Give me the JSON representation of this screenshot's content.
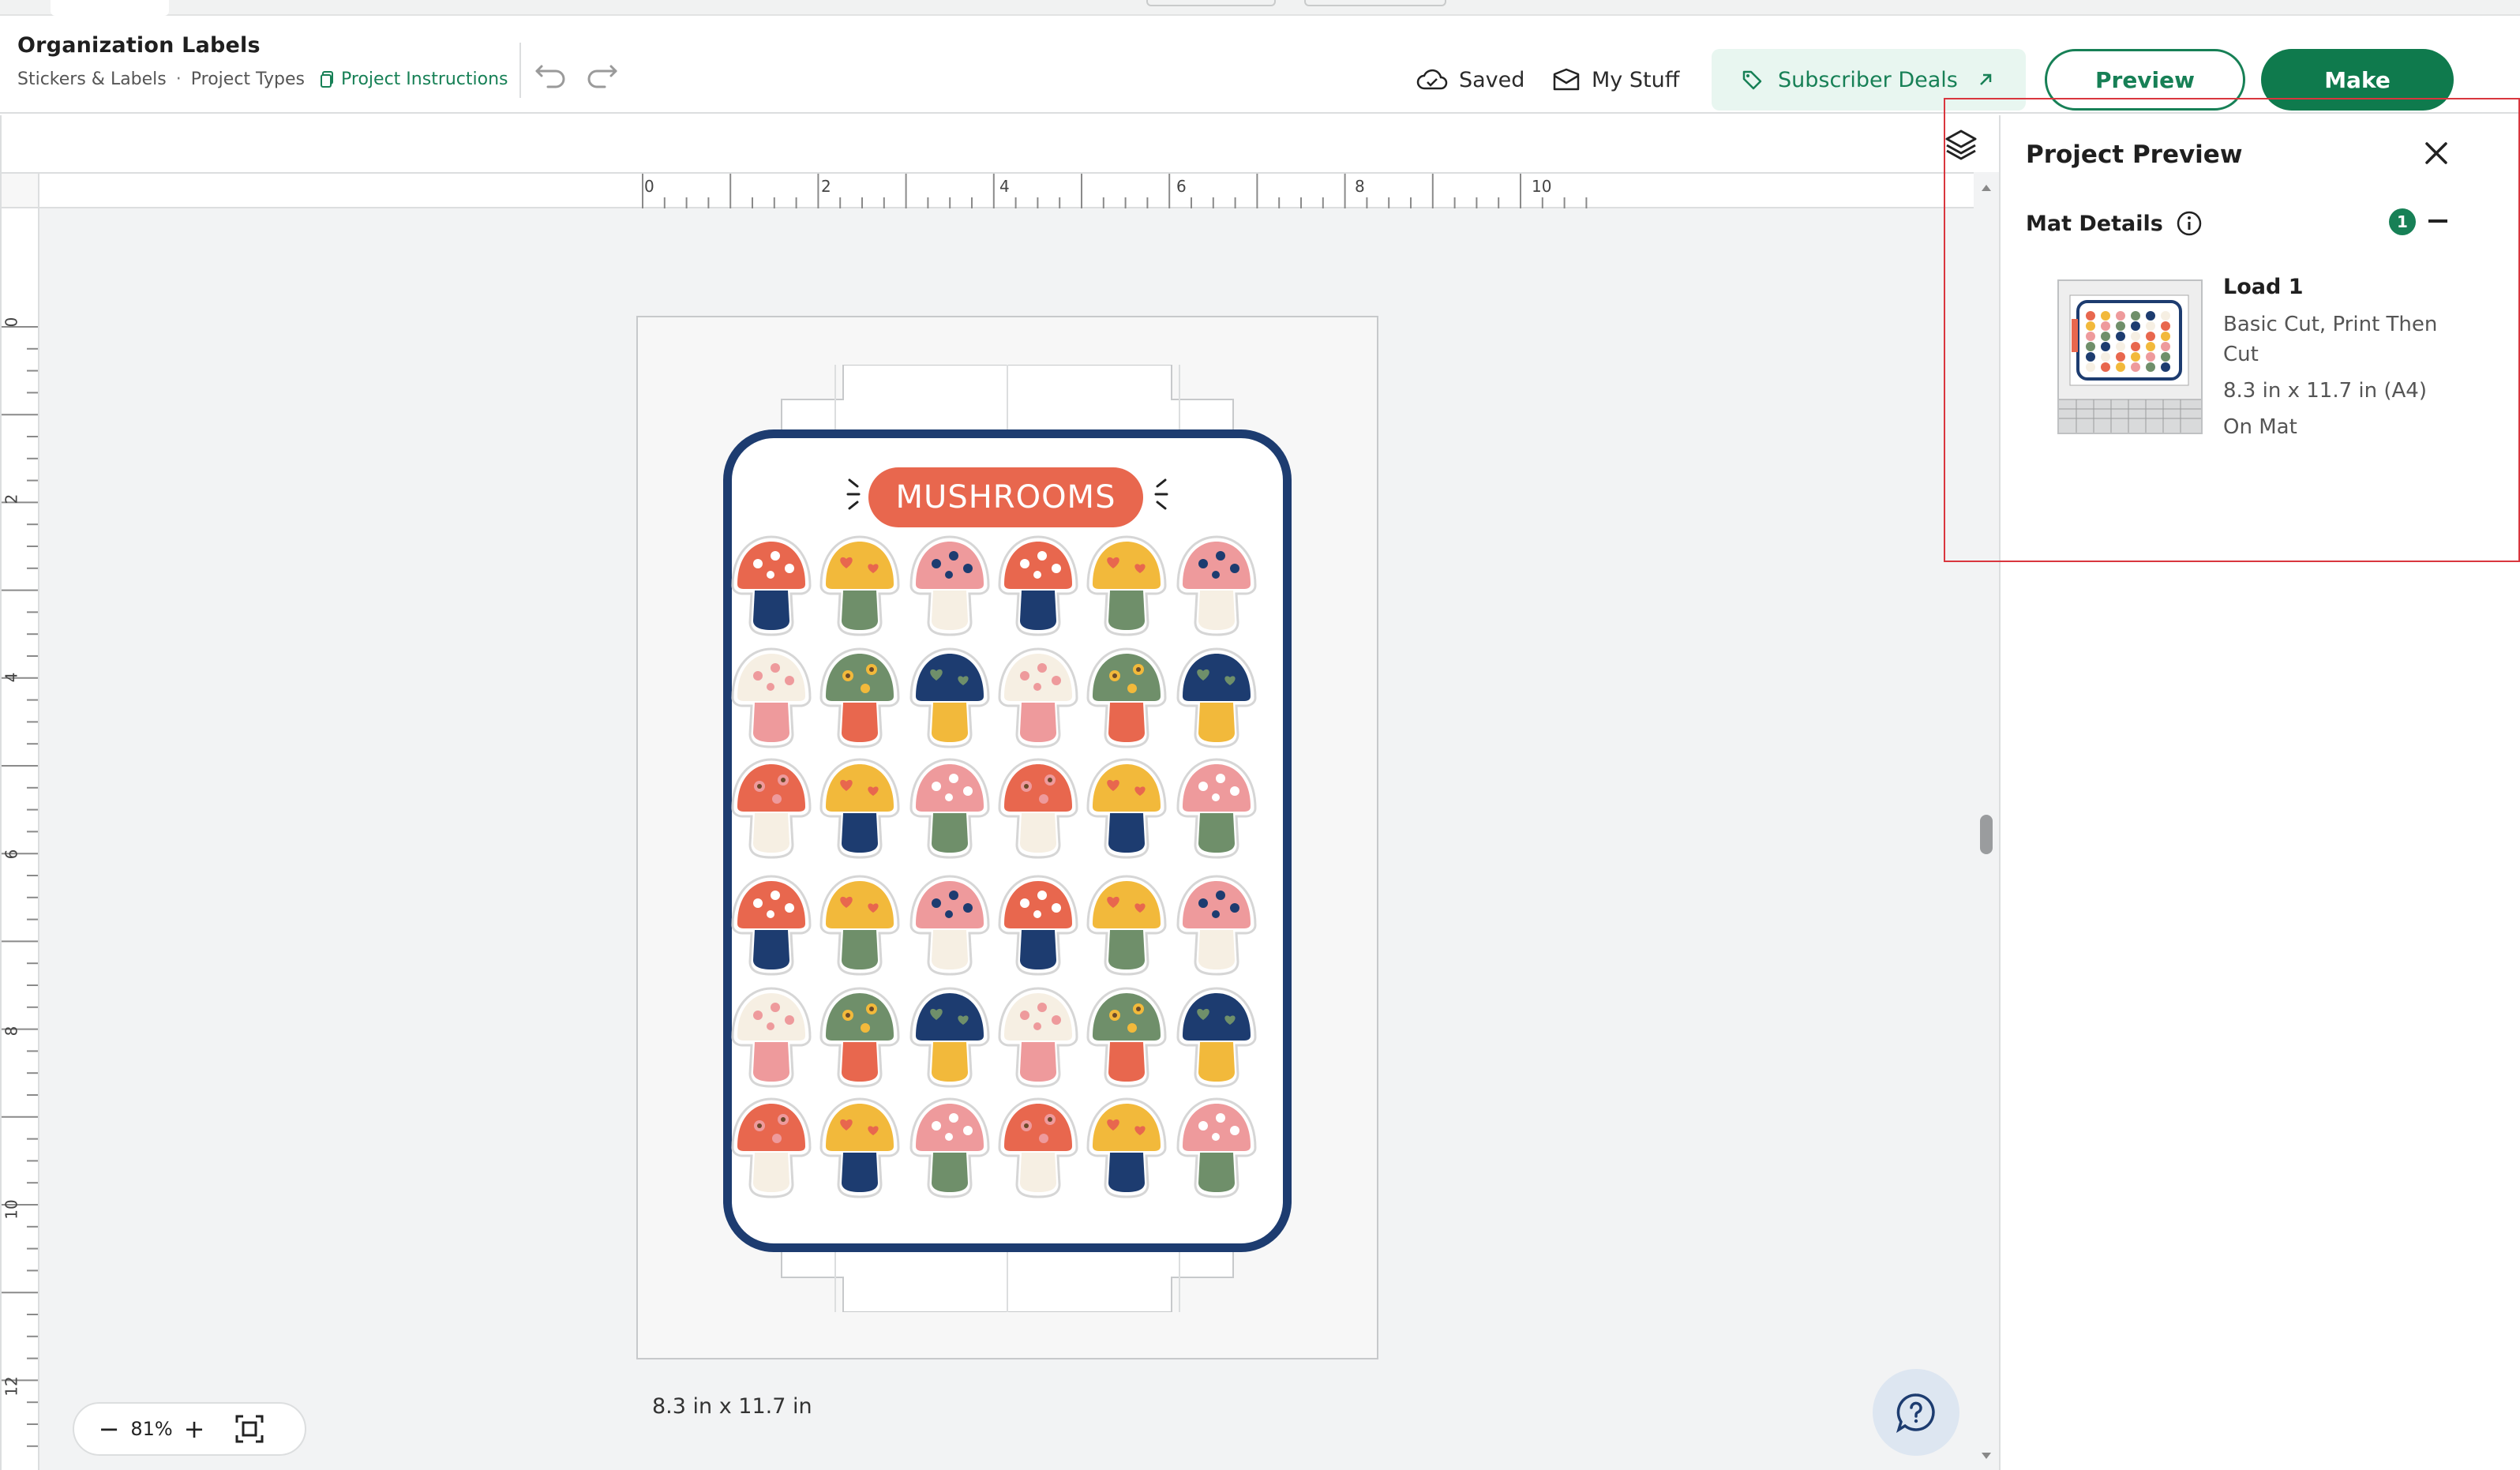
{
  "header": {
    "project_title": "Organization Labels",
    "breadcrumbs": [
      "Stickers & Labels",
      "Project Types"
    ],
    "instructions_link": "Project Instructions",
    "saved_label": "Saved",
    "mystuff_label": "My Stuff",
    "deals_label": "Subscriber Deals",
    "preview_label": "Preview",
    "make_label": "Make"
  },
  "canvas": {
    "ruler_h": [
      "0",
      "2",
      "4",
      "6",
      "8",
      "10"
    ],
    "ruler_v": [
      "0",
      "2",
      "4",
      "6",
      "8",
      "10",
      "12"
    ],
    "design_title": "MUSHROOMS",
    "size_label": "8.3 in x 11.7 in",
    "zoom_value": "81%",
    "colors": {
      "accent": "#0f7a4d",
      "card_border": "#1d3c70",
      "title_bg": "#e8674e",
      "selection": "#d9363e"
    }
  },
  "panel": {
    "title": "Project Preview",
    "section_label": "Mat Details",
    "section_count": "1",
    "load_title": "Load 1",
    "load_type": "Basic Cut, Print Then",
    "load_type_2": "Cut",
    "load_size": "8.3 in x 11.7 in (A4)",
    "load_location": "On Mat"
  },
  "icons": [
    "undo-icon",
    "redo-icon",
    "cloud-check-icon",
    "inbox-icon",
    "tag-icon",
    "external-arrow-icon",
    "layers-icon",
    "close-icon",
    "info-icon",
    "minus-icon",
    "fit-screen-icon",
    "help-chat-icon"
  ]
}
